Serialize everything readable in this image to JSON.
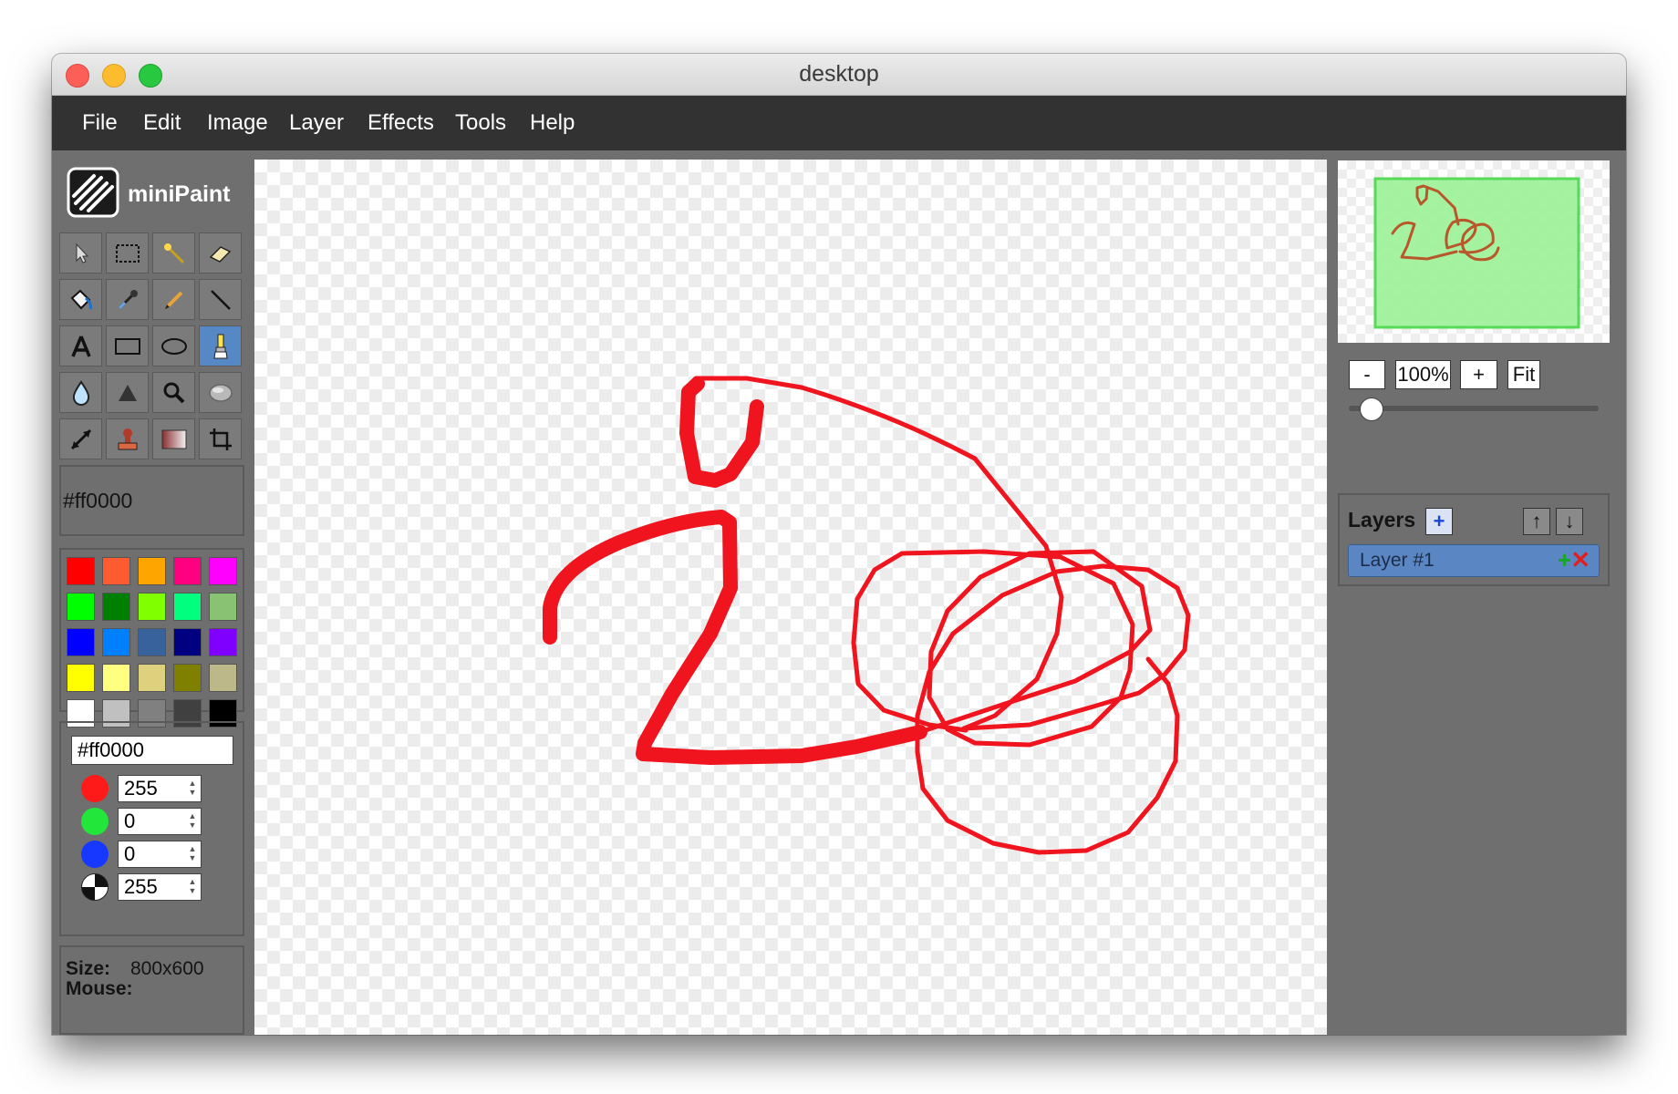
{
  "window": {
    "title": "desktop"
  },
  "menu": [
    "File",
    "Edit",
    "Image",
    "Layer",
    "Effects",
    "Tools",
    "Help"
  ],
  "app": {
    "name": "miniPaint"
  },
  "tools": [
    {
      "icon": "pointer-icon"
    },
    {
      "icon": "rect-select-icon"
    },
    {
      "icon": "magic-wand-icon"
    },
    {
      "icon": "eraser-icon"
    },
    {
      "icon": "fill-bucket-icon"
    },
    {
      "icon": "eyedropper-icon"
    },
    {
      "icon": "pencil-icon"
    },
    {
      "icon": "line-icon"
    },
    {
      "icon": "text-icon"
    },
    {
      "icon": "rectangle-icon"
    },
    {
      "icon": "ellipse-icon"
    },
    {
      "icon": "brush-icon",
      "active": true
    },
    {
      "icon": "blur-drop-icon"
    },
    {
      "icon": "sharpen-icon"
    },
    {
      "icon": "zoom-icon"
    },
    {
      "icon": "bulge-icon"
    },
    {
      "icon": "resize-arrows-icon"
    },
    {
      "icon": "clone-stamp-icon"
    },
    {
      "icon": "gradient-icon"
    },
    {
      "icon": "crop-icon"
    }
  ],
  "current_color": "#ff0000",
  "palette": [
    "#ff0000",
    "#ff5b31",
    "#ffa500",
    "#ff0080",
    "#ff00ff",
    "#00ff00",
    "#008000",
    "#7fff00",
    "#00ff7f",
    "#8ac273",
    "#0000ff",
    "#007fff",
    "#37629b",
    "#000080",
    "#8000ff",
    "#ffff00",
    "#ffff80",
    "#ddd17e",
    "#808000",
    "#bcb88a",
    "#ffffff",
    "#c0c0c0",
    "#808080",
    "#404040",
    "#000000"
  ],
  "picker": {
    "hex": "#ff0000",
    "red": "255",
    "green": "0",
    "blue": "0",
    "alpha": "255"
  },
  "info": {
    "size_label": "Size:",
    "size_value": "800x600",
    "mouse_label": "Mouse:"
  },
  "zoom": {
    "minus": "-",
    "level": "100%",
    "plus": "+",
    "fit": "Fit"
  },
  "layers": {
    "title": "Layers",
    "add": "+",
    "up": "↑",
    "down": "↓",
    "items": [
      {
        "name": "Layer #1"
      }
    ],
    "row_add": "+",
    "row_delete": "✕"
  },
  "colors": {
    "stroke": "#f0141e",
    "active_tool": "#5688c6",
    "layer_selected": "#5b86c4",
    "preview_bg": "#9ef29a"
  }
}
